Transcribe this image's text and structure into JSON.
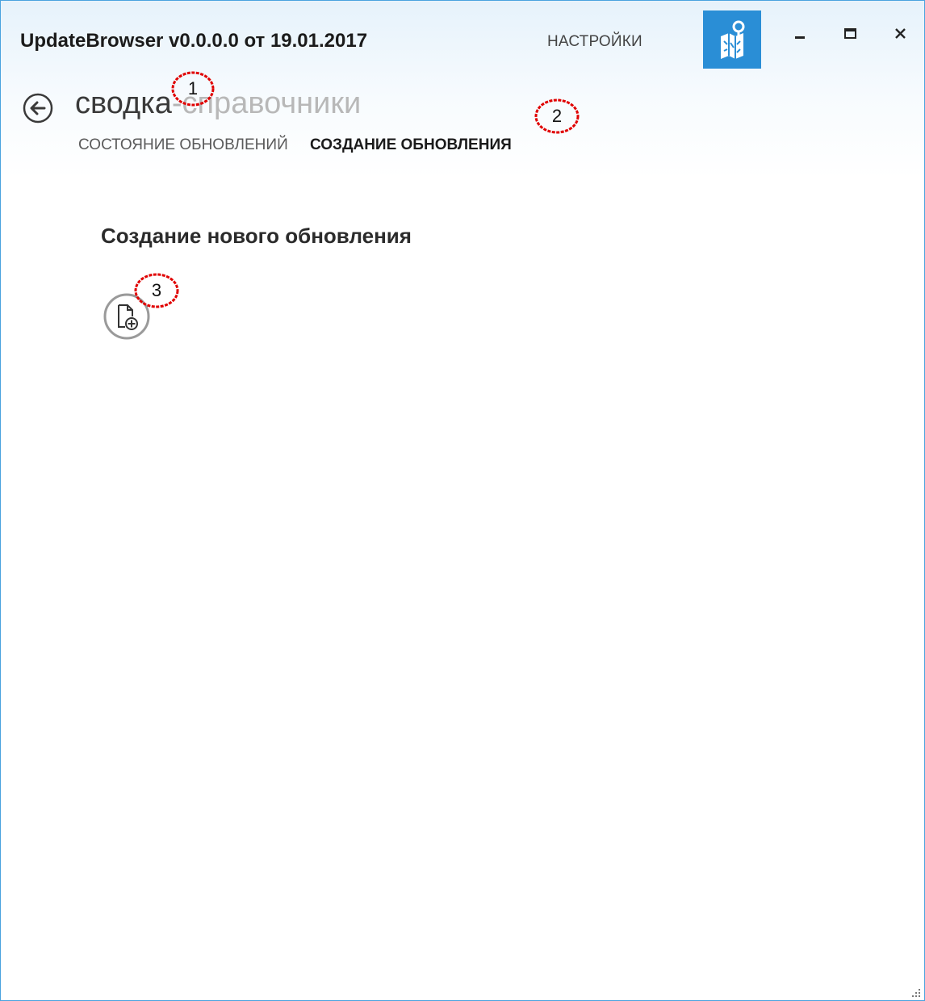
{
  "window": {
    "title": "UpdateBrowser v0.0.0.0 от 19.01.2017",
    "settings_label": "НАСТРОЙКИ"
  },
  "breadcrumb": {
    "items": [
      "сводка",
      "справочники"
    ],
    "separator": "-"
  },
  "tabs": [
    {
      "label": "СОСТОЯНИЕ ОБНОВЛЕНИЙ",
      "active": false
    },
    {
      "label": "СОЗДАНИЕ ОБНОВЛЕНИЯ",
      "active": true
    }
  ],
  "content": {
    "heading": "Создание нового обновления",
    "new_update_icon": "document-add-icon"
  },
  "annotations": [
    {
      "label": "1"
    },
    {
      "label": "2"
    },
    {
      "label": "3"
    }
  ],
  "colors": {
    "accent": "#2a8ed6",
    "annotation": "#e00000",
    "window_border": "#4aa3df"
  }
}
